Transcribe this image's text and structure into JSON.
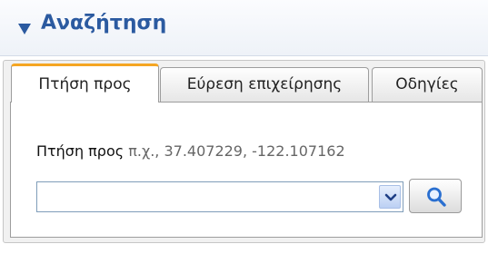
{
  "panel": {
    "title": "Αναζήτηση",
    "collapse_icon": "triangle-down-icon"
  },
  "tabs": [
    {
      "label": "Πτήση προς",
      "active": true
    },
    {
      "label": "Εύρεση επιχείρησης",
      "active": false
    },
    {
      "label": "Οδηγίες",
      "active": false
    }
  ],
  "goto": {
    "label": "Πτήση προς",
    "hint": "π.χ., 37.407229, -122.107162",
    "input_value": "",
    "dropdown_icon": "chevron-down-icon",
    "search_icon": "magnifier-icon"
  },
  "colors": {
    "title": "#2b5aa0",
    "active_tab_accent": "#f5a623"
  }
}
